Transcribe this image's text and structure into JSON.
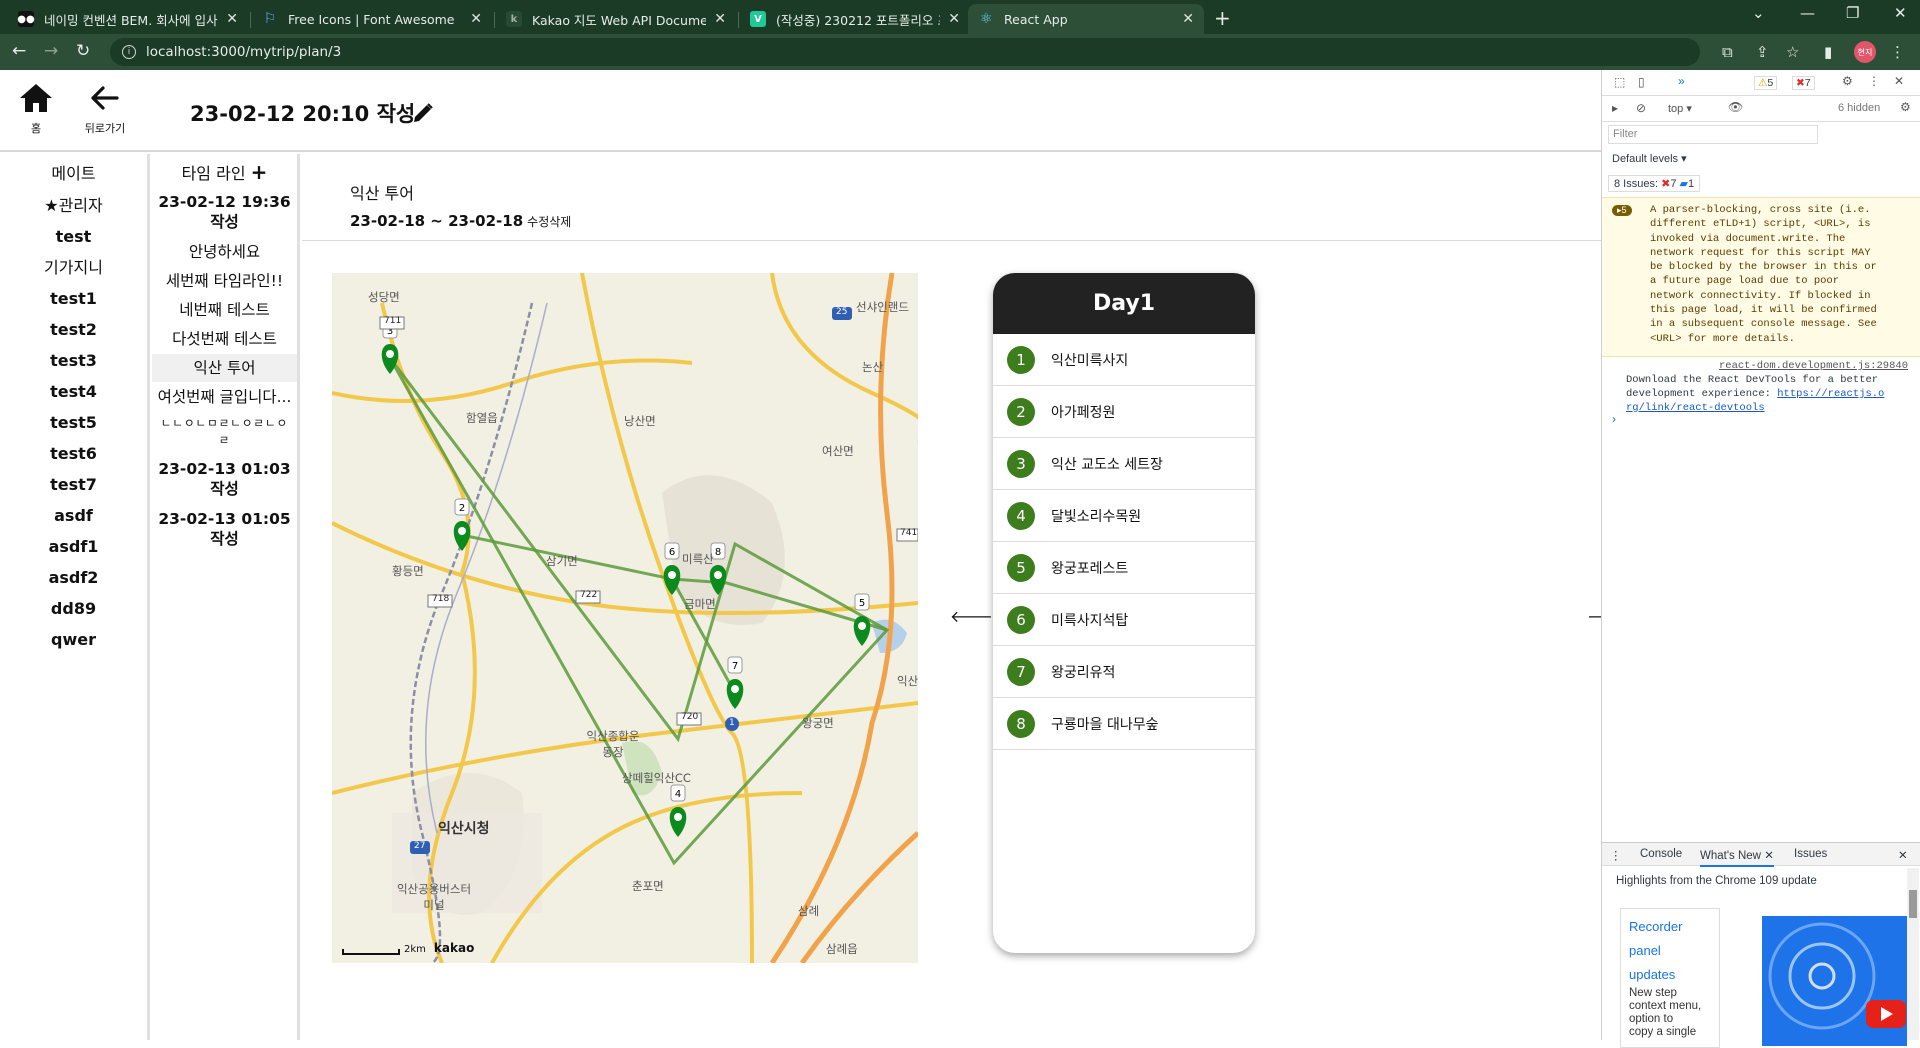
{
  "browser": {
    "tabs": [
      {
        "title": "네이밍 컨벤션 BEM. 회사에 입사",
        "icon": "bem-logo-icon"
      },
      {
        "title": "Free Icons | Font Awesome",
        "icon": "font-awesome-flag-icon"
      },
      {
        "title": "Kakao 지도 Web API Document",
        "icon": "kakao-icon"
      },
      {
        "title": "(작성중) 230212 포트폴리오 프로",
        "icon": "velog-icon"
      },
      {
        "title": "React App",
        "icon": "react-icon",
        "active": true
      }
    ],
    "url": "localhost:3000/mytrip/plan/3"
  },
  "header": {
    "home_caption": "홈",
    "back_caption": "뒤로가기",
    "plan_title": "23-02-12 20:10 작성"
  },
  "mates": {
    "title": "메이트",
    "admin_label": "관리자",
    "members": [
      "test",
      "기가지니",
      "test1",
      "test2",
      "test3",
      "test4",
      "test5",
      "test6",
      "test7",
      "asdf",
      "asdf1",
      "asdf2",
      "dd89",
      "qwer"
    ]
  },
  "timeline": {
    "title": "타임 라인",
    "items": [
      "23-02-12 19:36 작성",
      "안녕하세요",
      "세번째 타임라인!!",
      "네번째 테스트",
      "다섯번째 테스트",
      "익산 투어",
      "여섯번째 글입니다...",
      "ㄴㄴㅇㄴㅁㄹㄴㅇㄹㄴㅇㄹ",
      "23-02-13 01:03 작성",
      "23-02-13 01:05 작성"
    ]
  },
  "trip": {
    "name": "익산 투어",
    "dates": "23-02-18 ~ 23-02-18",
    "edit_label": "수정",
    "delete_label": "삭제"
  },
  "map": {
    "labels": [
      "성당면",
      "함열읍",
      "낭산면",
      "여산면",
      "황등면",
      "삼기면",
      "미륵산",
      "금마면",
      "익산종합운동장",
      "왕궁면",
      "상떼힐익산CC",
      "익산시청",
      "익산공용버스터미널",
      "춘포면",
      "삼례",
      "삼례읍",
      "논산",
      "선샤인랜드",
      "익산"
    ],
    "road_numbers": [
      "711",
      "25",
      "741",
      "718",
      "722",
      "720",
      "27",
      "1"
    ],
    "scale": "2km",
    "brand": "kakao",
    "marker_color": "#0b8a1e",
    "route_color": "#5c9a3a"
  },
  "day": {
    "title": "Day1",
    "stops": [
      "익산미륵사지",
      "아가페정원",
      "익산 교도소 세트장",
      "달빛소리수목원",
      "왕궁포레스트",
      "미륵사지석탑",
      "왕궁리유적",
      "구룡마을 대나무숲"
    ],
    "accent": "#3e7d1d"
  },
  "devtools": {
    "warn_count": "5",
    "error_count": "7",
    "context": "top",
    "hidden": "6 hidden",
    "filter_placeholder": "Filter",
    "levels": "Default levels",
    "issues_label": "8 Issues:",
    "issues_errors": "7",
    "issues_info": "1",
    "warn_badge": "5",
    "warning_text": "A parser-blocking, cross site (i.e.\ndifferent eTLD+1) script, <URL>, is\ninvoked via document.write. The\nnetwork request for this script MAY\nbe blocked by the browser in this or\na future page load due to poor\nnetwork connectivity. If blocked in\nthis page load, it will be confirmed\nin a subsequent console message. See\n<URL> for more details.",
    "source_link": "react-dom.development.js:29840",
    "devtools_msg": "Download the React DevTools for a better\ndevelopment experience: ",
    "devtools_link_a": "https://reactjs.o",
    "devtools_link_b": "rg/link/react-devtools",
    "drawer_tabs": [
      "Console",
      "What's New",
      "Issues"
    ],
    "highlights": "Highlights from the Chrome 109 update",
    "card_title": [
      "Recorder",
      "panel",
      "updates"
    ],
    "card_desc": [
      "New step",
      "context menu,",
      "option to",
      "copy a single"
    ]
  }
}
